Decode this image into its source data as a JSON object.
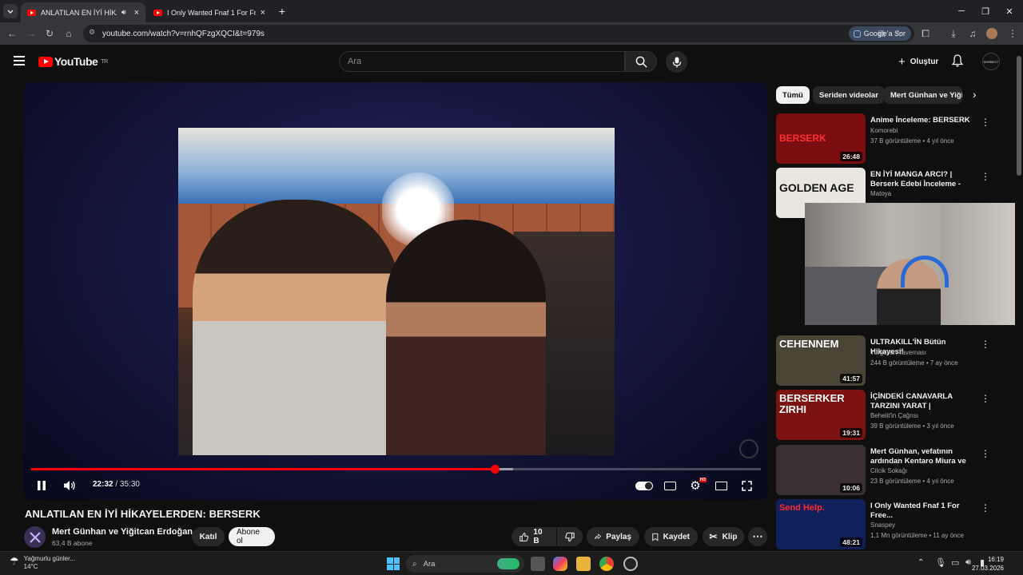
{
  "browser": {
    "tabs": [
      {
        "title": "ANLATILAN EN İYİ HİKAYELER",
        "active": true
      },
      {
        "title": "I Only Wanted Fnaf 1 For Free...",
        "active": false
      }
    ],
    "new_tab": "+",
    "url": "youtube.com/watch?v=rnhQFzgXQCI&t=979s",
    "google_ask": "Google'a Sor"
  },
  "header": {
    "logo": "YouTube",
    "country": "TR",
    "search_placeholder": "Ara",
    "create_label": "Oluştur",
    "avatar_text": "SERBEST"
  },
  "player": {
    "current_time": "22:32",
    "separator": "/",
    "duration": "35:30",
    "progress_fraction": 0.635,
    "buffer_fraction": 0.66,
    "hd_badge": "HD"
  },
  "video": {
    "title": "ANLATILAN EN İYİ HİKAYELERDEN: BERSERK",
    "channel": "Mert Günhan ve Yiğitcan Erdoğan",
    "subscribers": "63,4 B abone",
    "join_label": "Katıl",
    "subscribe_label": "Abone ol",
    "likes": "10 B",
    "share_label": "Paylaş",
    "save_label": "Kaydet",
    "clip_label": "Klip"
  },
  "sidebar": {
    "chips": [
      "Tümü",
      "Seriden videolar",
      "Mert Günhan ve Yiğitcan"
    ],
    "recommendations": [
      {
        "title": "Anime İnceleme: BERSERK",
        "channel": "Komorebi",
        "stats": "37 B görüntüleme • 4 yıl önce",
        "duration": "26:48",
        "thumb_color": "#7a0d10",
        "thumb_text": "BERSERK"
      },
      {
        "title": "EN İYİ MANGA ARCI? | Berserk Edebi İnceleme - Golden Age #1",
        "channel": "Matoya",
        "stats": "",
        "duration": "",
        "thumb_color": "#e9e6df",
        "thumb_text": "GOLDEN AGE"
      },
      {
        "title": "ULTRAKILL'İN Bütün Hikayesi!",
        "channel": "Turgut'un Tavernası",
        "stats": "244 B görüntüleme • 7 ay önce",
        "duration": "41:57",
        "thumb_color": "#4a4436",
        "thumb_text": "CEHENNEM"
      },
      {
        "title": "İÇİNDEKİ CANAVARLA TARZINI YARAT | BERSERKER ZIRHI | ...",
        "channel": "Behelit'in Çağrısı",
        "stats": "39 B görüntüleme • 3 yıl önce",
        "duration": "19:31",
        "thumb_color": "#7d1212",
        "thumb_text": "BERSERKER ZIRHI"
      },
      {
        "title": "Mert Günhan, vefatının ardından Kentaro Miura ve Berserk ...",
        "channel": "Cilcik Sokağı",
        "stats": "23 B görüntüleme • 4 yıl önce",
        "duration": "10:06",
        "thumb_color": "#3a3034",
        "thumb_text": ""
      },
      {
        "title": "I Only Wanted Fnaf 1 For Free...",
        "channel": "Snaspey",
        "stats": "1,1 Mn görüntüleme • 11 ay önce",
        "duration": "48:21",
        "thumb_color": "#10205a",
        "thumb_text": "Send Help."
      }
    ]
  },
  "taskbar": {
    "weather_text": "Yağmurlu günler...",
    "temperature": "14°C",
    "search_placeholder": "Ara",
    "time": "16:19",
    "date": "27.03.2026"
  },
  "colors": {
    "accent_red": "#ff0000",
    "background": "#0f0f0f",
    "chip_bg": "#272727"
  }
}
